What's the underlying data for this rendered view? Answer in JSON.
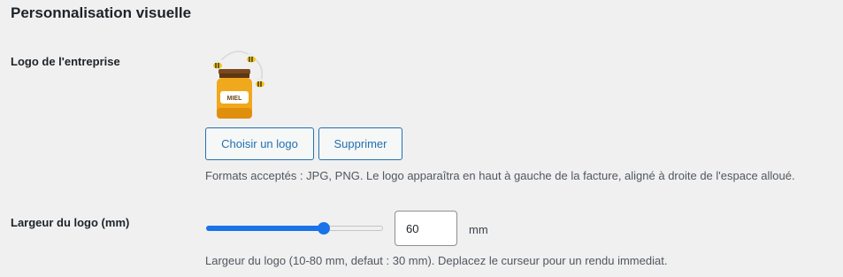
{
  "section": {
    "title": "Personnalisation visuelle"
  },
  "logo": {
    "label": "Logo de l'entreprise",
    "jar_text": "MIEL",
    "choose_button": "Choisir un logo",
    "remove_button": "Supprimer",
    "help": "Formats acceptés : JPG, PNG. Le logo apparaîtra en haut à gauche de la facture, aligné à droite de l'espace alloué."
  },
  "width": {
    "label": "Largeur du logo (mm)",
    "min": 10,
    "max": 80,
    "value": 60,
    "value_text": "60",
    "unit": "mm",
    "help": "Largeur du logo (10-80 mm, defaut : 30 mm). Deplacez le curseur pour un rendu immediat."
  },
  "colors": {
    "accent": "#2271b1",
    "slider": "#1a73e8",
    "honey": "#f0a81c"
  }
}
